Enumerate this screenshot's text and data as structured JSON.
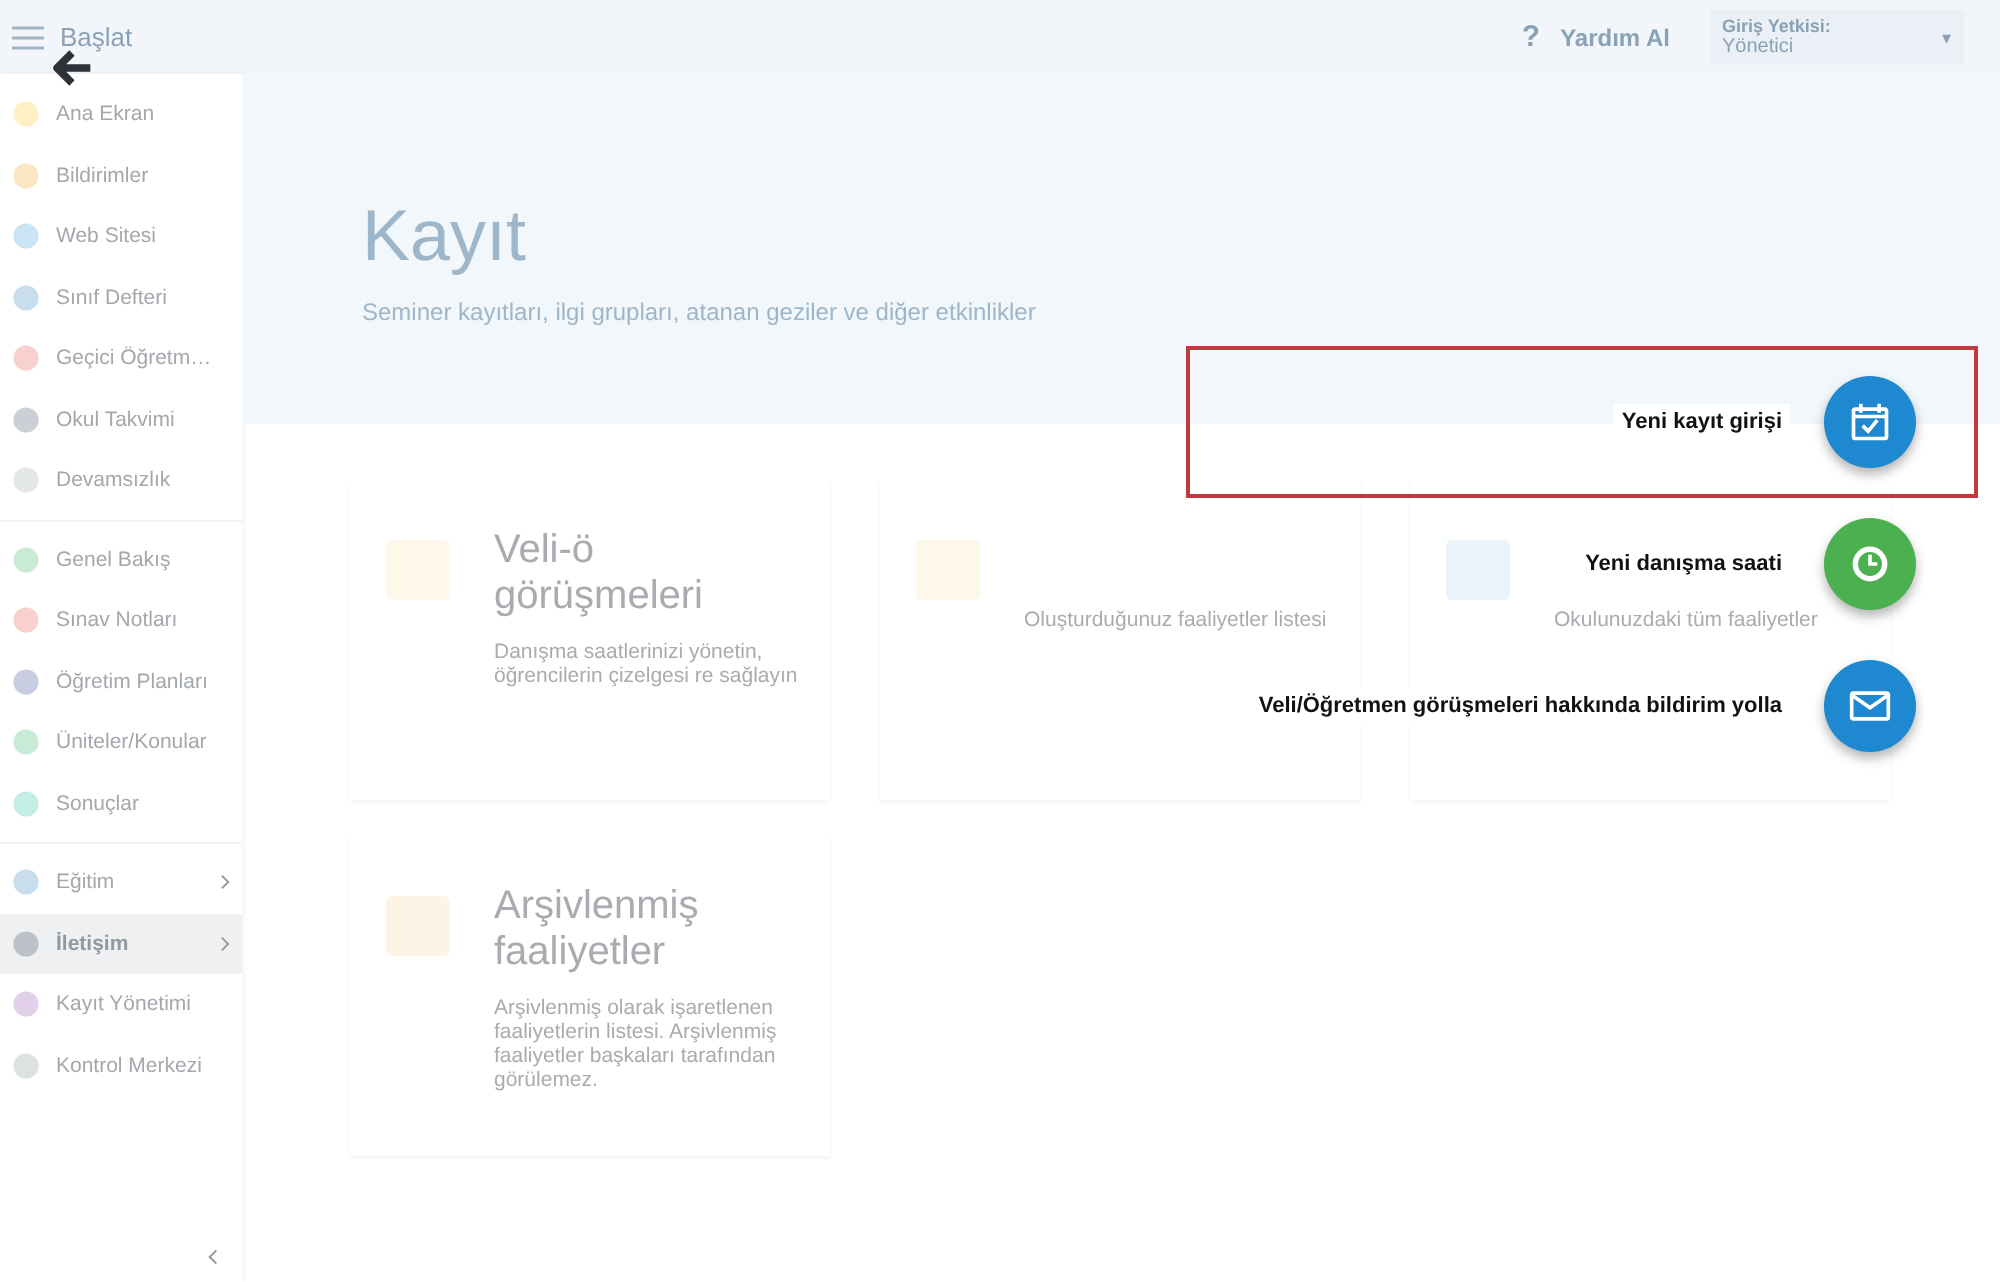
{
  "topbar": {
    "menu_label": "Başlat",
    "help_icon": "?",
    "help": "Yardım Al",
    "caret": "▾",
    "role_label": "Giriş Yetkisi:",
    "role_value": "Yönetici"
  },
  "sidebar": {
    "groups": [
      [
        {
          "label": "Ana Ekran",
          "selected": false
        },
        {
          "label": "Bildirimler",
          "selected": false
        },
        {
          "label": "Web Sitesi",
          "selected": false
        },
        {
          "label": "Sınıf Defteri",
          "selected": false
        },
        {
          "label": "Geçici Öğretm…",
          "selected": false
        },
        {
          "label": "Okul Takvimi",
          "selected": false
        },
        {
          "label": "Devamsızlık",
          "selected": false
        }
      ],
      [
        {
          "label": "Genel Bakış",
          "selected": false
        },
        {
          "label": "Sınav Notları",
          "selected": false
        },
        {
          "label": "Öğretim Planları",
          "selected": false
        },
        {
          "label": "Üniteler/Konular",
          "selected": false
        },
        {
          "label": "Sonuçlar",
          "selected": false
        }
      ],
      [
        {
          "label": "Eğitim",
          "selected": false,
          "expandable": true
        },
        {
          "label": "İletişim",
          "selected": true,
          "expandable": true
        },
        {
          "label": "Kayıt Yönetimi",
          "selected": false,
          "expandable": false
        },
        {
          "label": "Kontrol Merkezi",
          "selected": false,
          "expandable": false
        }
      ]
    ]
  },
  "hero": {
    "title": "Kayıt",
    "subtitle": "Seminer kayıtları, ilgi grupları, atanan geziler ve diğer etkinlikler"
  },
  "cards": [
    {
      "title": "Veli-ö görüşmeleri",
      "description": "Danışma saatlerinizi yönetin, öğrencilerin çizelgesi re sağlayın"
    },
    {
      "description": "Oluşturduğunuz faaliyetler listesi"
    },
    {
      "description": "Okulunuzdaki tüm faaliyetler"
    },
    {
      "title": "Arşivlenmiş faaliyetler",
      "description": "Arşivlenmiş olarak işaretlenen faaliyetlerin listesi. Arşivlenmiş faaliyetler başkaları tarafından görülemez."
    }
  ],
  "actions": [
    {
      "label": "Yeni kayıt girişi",
      "kind": "calendar",
      "highlighted": true
    },
    {
      "label": "Yeni danışma saati",
      "kind": "clock",
      "highlighted": false
    },
    {
      "label": "Veli/Öğretmen görüşmeleri hakkında bildirim yolla",
      "kind": "mail",
      "highlighted": false
    }
  ]
}
